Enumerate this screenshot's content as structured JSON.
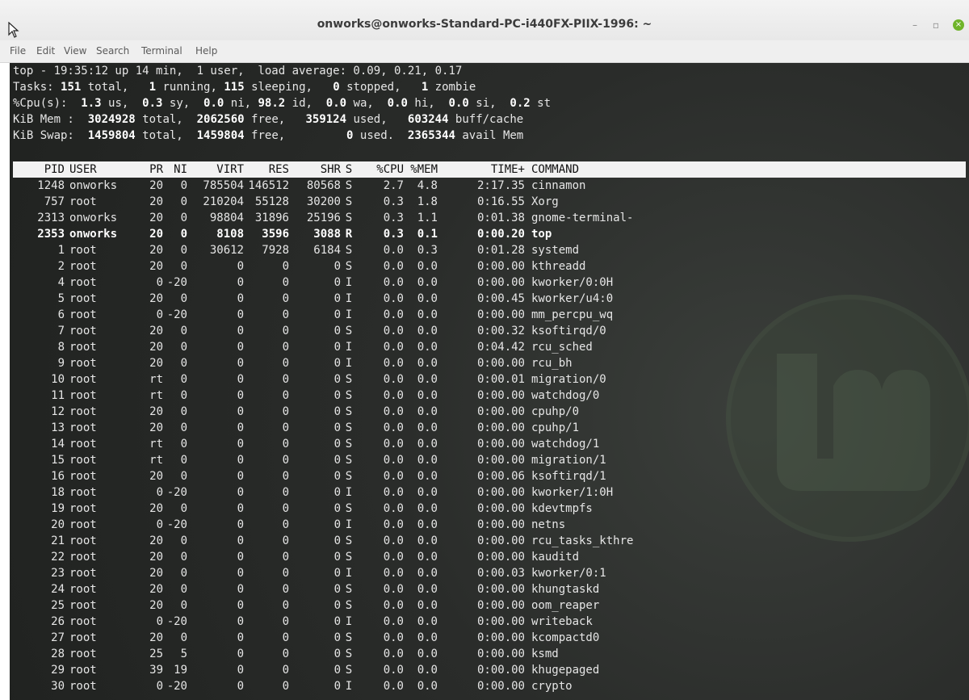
{
  "window": {
    "title": "onworks@onworks-Standard-PC-i440FX-PIIX-1996: ~",
    "controls": [
      "–",
      "▫",
      "×"
    ],
    "accent": "#6fb42a"
  },
  "menu": [
    "File",
    "Edit",
    "View",
    "Search",
    "Terminal",
    "Help"
  ],
  "summary": {
    "line1": "top - 19:35:12 up 14 min,  1 user,  load average: 0.09, 0.21, 0.17",
    "tasks": {
      "label": "Tasks:",
      "total": "151",
      "running": "1",
      "sleeping": "115",
      "stopped": "0",
      "zombie": "1"
    },
    "cpu": {
      "label": "%Cpu(s):",
      "us": "1.3",
      "sy": "0.3",
      "ni": "0.0",
      "id": "98.2",
      "wa": "0.0",
      "hi": "0.0",
      "si": "0.0",
      "st": "0.2"
    },
    "mem": {
      "label": "KiB Mem :",
      "total": "3024928",
      "free": "2062560",
      "used": "359124",
      "buff": "603244"
    },
    "swap": {
      "label": "KiB Swap:",
      "total": "1459804",
      "free": "1459804",
      "used": "0",
      "avail": "2365344"
    }
  },
  "columns": [
    "PID",
    "USER",
    "PR",
    "NI",
    "VIRT",
    "RES",
    "SHR",
    "S",
    "%CPU",
    "%MEM",
    "TIME+",
    "COMMAND"
  ],
  "processes": [
    [
      "1248",
      "onworks",
      "20",
      "0",
      "785504",
      "146512",
      "80568",
      "S",
      "2.7",
      "4.8",
      "2:17.35",
      "cinnamon"
    ],
    [
      "757",
      "root",
      "20",
      "0",
      "210204",
      "55128",
      "30200",
      "S",
      "0.3",
      "1.8",
      "0:16.55",
      "Xorg"
    ],
    [
      "2313",
      "onworks",
      "20",
      "0",
      "98804",
      "31896",
      "25196",
      "S",
      "0.3",
      "1.1",
      "0:01.38",
      "gnome-terminal-"
    ],
    [
      "2353",
      "onworks",
      "20",
      "0",
      "8108",
      "3596",
      "3088",
      "R",
      "0.3",
      "0.1",
      "0:00.20",
      "top"
    ],
    [
      "1",
      "root",
      "20",
      "0",
      "30612",
      "7928",
      "6184",
      "S",
      "0.0",
      "0.3",
      "0:01.28",
      "systemd"
    ],
    [
      "2",
      "root",
      "20",
      "0",
      "0",
      "0",
      "0",
      "S",
      "0.0",
      "0.0",
      "0:00.00",
      "kthreadd"
    ],
    [
      "4",
      "root",
      "0",
      "-20",
      "0",
      "0",
      "0",
      "I",
      "0.0",
      "0.0",
      "0:00.00",
      "kworker/0:0H"
    ],
    [
      "5",
      "root",
      "20",
      "0",
      "0",
      "0",
      "0",
      "I",
      "0.0",
      "0.0",
      "0:00.45",
      "kworker/u4:0"
    ],
    [
      "6",
      "root",
      "0",
      "-20",
      "0",
      "0",
      "0",
      "I",
      "0.0",
      "0.0",
      "0:00.00",
      "mm_percpu_wq"
    ],
    [
      "7",
      "root",
      "20",
      "0",
      "0",
      "0",
      "0",
      "S",
      "0.0",
      "0.0",
      "0:00.32",
      "ksoftirqd/0"
    ],
    [
      "8",
      "root",
      "20",
      "0",
      "0",
      "0",
      "0",
      "I",
      "0.0",
      "0.0",
      "0:04.42",
      "rcu_sched"
    ],
    [
      "9",
      "root",
      "20",
      "0",
      "0",
      "0",
      "0",
      "I",
      "0.0",
      "0.0",
      "0:00.00",
      "rcu_bh"
    ],
    [
      "10",
      "root",
      "rt",
      "0",
      "0",
      "0",
      "0",
      "S",
      "0.0",
      "0.0",
      "0:00.01",
      "migration/0"
    ],
    [
      "11",
      "root",
      "rt",
      "0",
      "0",
      "0",
      "0",
      "S",
      "0.0",
      "0.0",
      "0:00.00",
      "watchdog/0"
    ],
    [
      "12",
      "root",
      "20",
      "0",
      "0",
      "0",
      "0",
      "S",
      "0.0",
      "0.0",
      "0:00.00",
      "cpuhp/0"
    ],
    [
      "13",
      "root",
      "20",
      "0",
      "0",
      "0",
      "0",
      "S",
      "0.0",
      "0.0",
      "0:00.00",
      "cpuhp/1"
    ],
    [
      "14",
      "root",
      "rt",
      "0",
      "0",
      "0",
      "0",
      "S",
      "0.0",
      "0.0",
      "0:00.00",
      "watchdog/1"
    ],
    [
      "15",
      "root",
      "rt",
      "0",
      "0",
      "0",
      "0",
      "S",
      "0.0",
      "0.0",
      "0:00.00",
      "migration/1"
    ],
    [
      "16",
      "root",
      "20",
      "0",
      "0",
      "0",
      "0",
      "S",
      "0.0",
      "0.0",
      "0:00.06",
      "ksoftirqd/1"
    ],
    [
      "18",
      "root",
      "0",
      "-20",
      "0",
      "0",
      "0",
      "I",
      "0.0",
      "0.0",
      "0:00.00",
      "kworker/1:0H"
    ],
    [
      "19",
      "root",
      "20",
      "0",
      "0",
      "0",
      "0",
      "S",
      "0.0",
      "0.0",
      "0:00.00",
      "kdevtmpfs"
    ],
    [
      "20",
      "root",
      "0",
      "-20",
      "0",
      "0",
      "0",
      "I",
      "0.0",
      "0.0",
      "0:00.00",
      "netns"
    ],
    [
      "21",
      "root",
      "20",
      "0",
      "0",
      "0",
      "0",
      "S",
      "0.0",
      "0.0",
      "0:00.00",
      "rcu_tasks_kthre"
    ],
    [
      "22",
      "root",
      "20",
      "0",
      "0",
      "0",
      "0",
      "S",
      "0.0",
      "0.0",
      "0:00.00",
      "kauditd"
    ],
    [
      "23",
      "root",
      "20",
      "0",
      "0",
      "0",
      "0",
      "I",
      "0.0",
      "0.0",
      "0:00.03",
      "kworker/0:1"
    ],
    [
      "24",
      "root",
      "20",
      "0",
      "0",
      "0",
      "0",
      "S",
      "0.0",
      "0.0",
      "0:00.00",
      "khungtaskd"
    ],
    [
      "25",
      "root",
      "20",
      "0",
      "0",
      "0",
      "0",
      "S",
      "0.0",
      "0.0",
      "0:00.00",
      "oom_reaper"
    ],
    [
      "26",
      "root",
      "0",
      "-20",
      "0",
      "0",
      "0",
      "I",
      "0.0",
      "0.0",
      "0:00.00",
      "writeback"
    ],
    [
      "27",
      "root",
      "20",
      "0",
      "0",
      "0",
      "0",
      "S",
      "0.0",
      "0.0",
      "0:00.00",
      "kcompactd0"
    ],
    [
      "28",
      "root",
      "25",
      "5",
      "0",
      "0",
      "0",
      "S",
      "0.0",
      "0.0",
      "0:00.00",
      "ksmd"
    ],
    [
      "29",
      "root",
      "39",
      "19",
      "0",
      "0",
      "0",
      "S",
      "0.0",
      "0.0",
      "0:00.00",
      "khugepaged"
    ],
    [
      "30",
      "root",
      "0",
      "-20",
      "0",
      "0",
      "0",
      "I",
      "0.0",
      "0.0",
      "0:00.00",
      "crypto"
    ]
  ],
  "highlight_pid": "2353"
}
